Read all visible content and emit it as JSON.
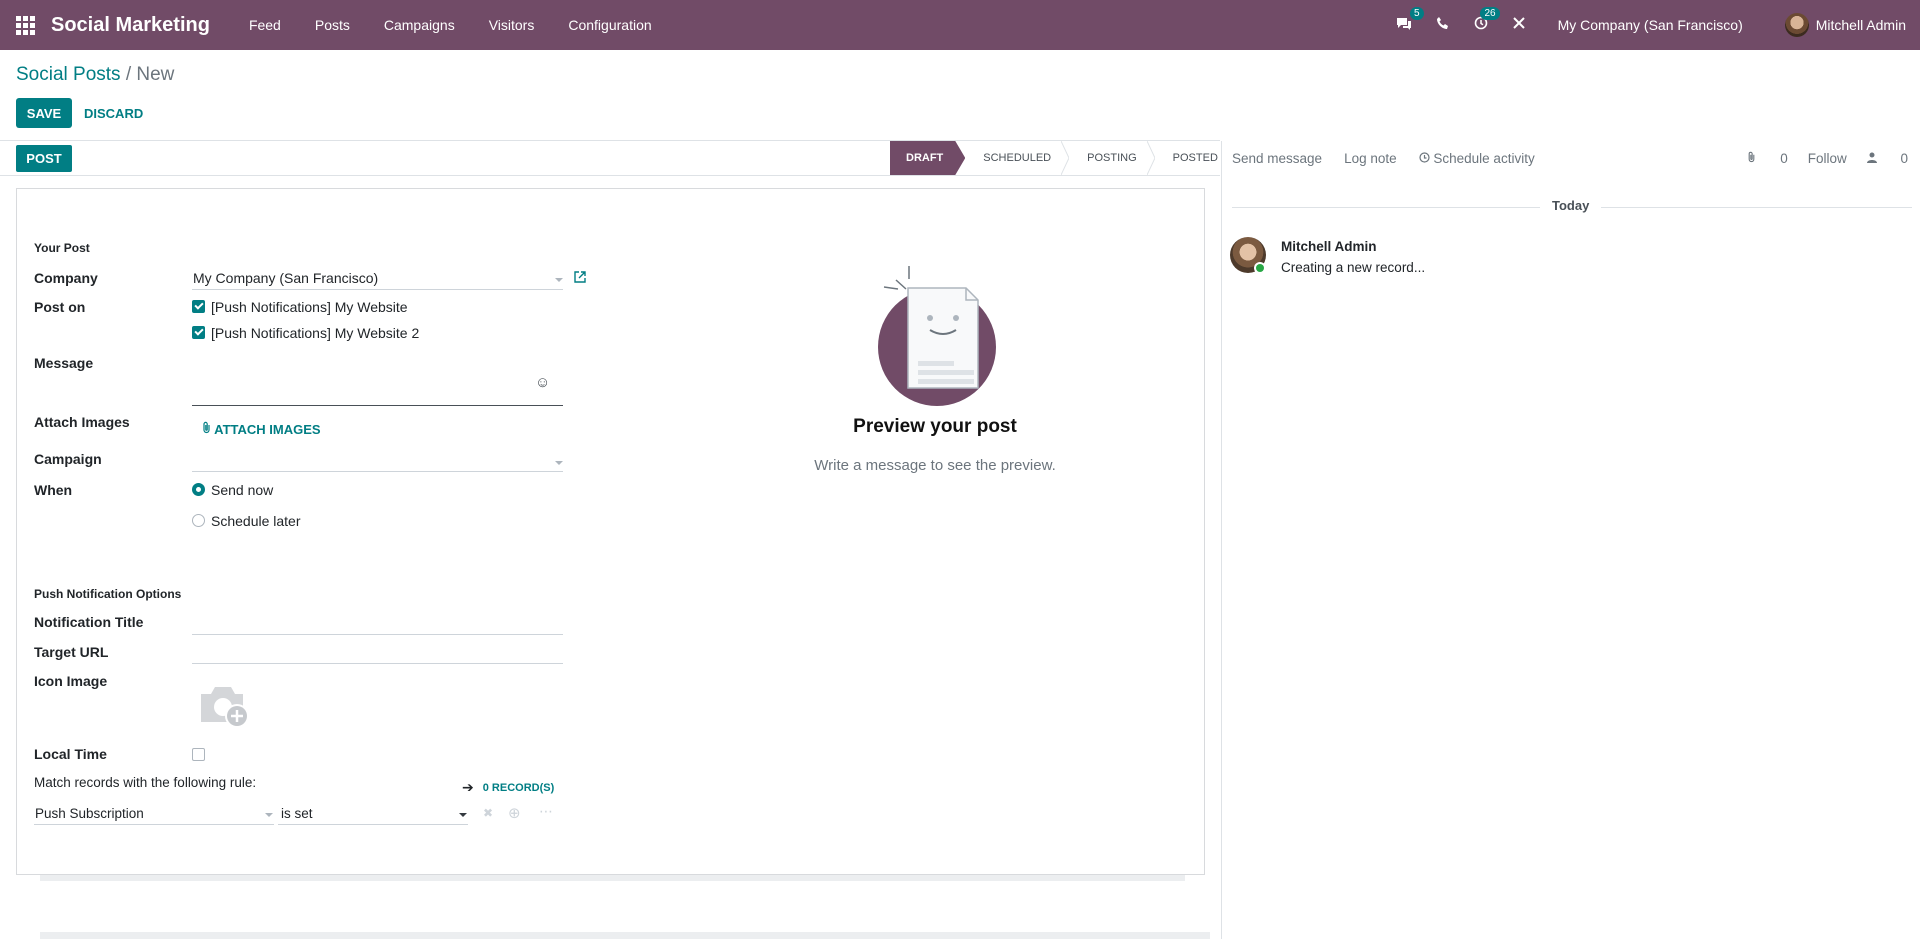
{
  "navbar": {
    "app_name": "Social Marketing",
    "menu": [
      "Feed",
      "Posts",
      "Campaigns",
      "Visitors",
      "Configuration"
    ],
    "messages_badge": "5",
    "activities_badge": "26",
    "company": "My Company (San Francisco)",
    "user": "Mitchell Admin"
  },
  "breadcrumb": {
    "parent": "Social Posts",
    "separator": "/",
    "current": "New"
  },
  "actions": {
    "save": "SAVE",
    "discard": "DISCARD",
    "post": "POST"
  },
  "statusbar": {
    "stages": [
      "DRAFT",
      "SCHEDULED",
      "POSTING",
      "POSTED"
    ],
    "active": "DRAFT"
  },
  "form": {
    "section_post": "Your Post",
    "company_label": "Company",
    "company_value": "My Company (San Francisco)",
    "post_on_label": "Post on",
    "accounts": [
      "[Push Notifications] My Website",
      "[Push Notifications] My Website 2"
    ],
    "message_label": "Message",
    "message_value": "",
    "emoji_icon": "☺",
    "attach_label": "Attach Images",
    "attach_button": "ATTACH IMAGES",
    "campaign_label": "Campaign",
    "campaign_value": "",
    "when_label": "When",
    "when_options": [
      "Send now",
      "Schedule later"
    ],
    "when_selected": "Send now",
    "section_push": "Push Notification Options",
    "notification_title_label": "Notification Title",
    "target_url_label": "Target URL",
    "icon_image_label": "Icon Image",
    "local_time_label": "Local Time",
    "local_time_checked": false,
    "match_rule_text": "Match records with the following rule:",
    "records_link": "0 RECORD(S)",
    "domain_field": "Push Subscription",
    "domain_operator": "is set"
  },
  "preview": {
    "title": "Preview your post",
    "subtitle": "Write a message to see the preview."
  },
  "chatter": {
    "send_message": "Send message",
    "log_note": "Log note",
    "schedule_activity": "Schedule activity",
    "attachments_count": "0",
    "follow": "Follow",
    "followers_count": "0",
    "date_separator": "Today",
    "message_author": "Mitchell Admin",
    "message_body": "Creating a new record..."
  },
  "colors": {
    "brand": "#714b67",
    "accent": "#017e84"
  }
}
